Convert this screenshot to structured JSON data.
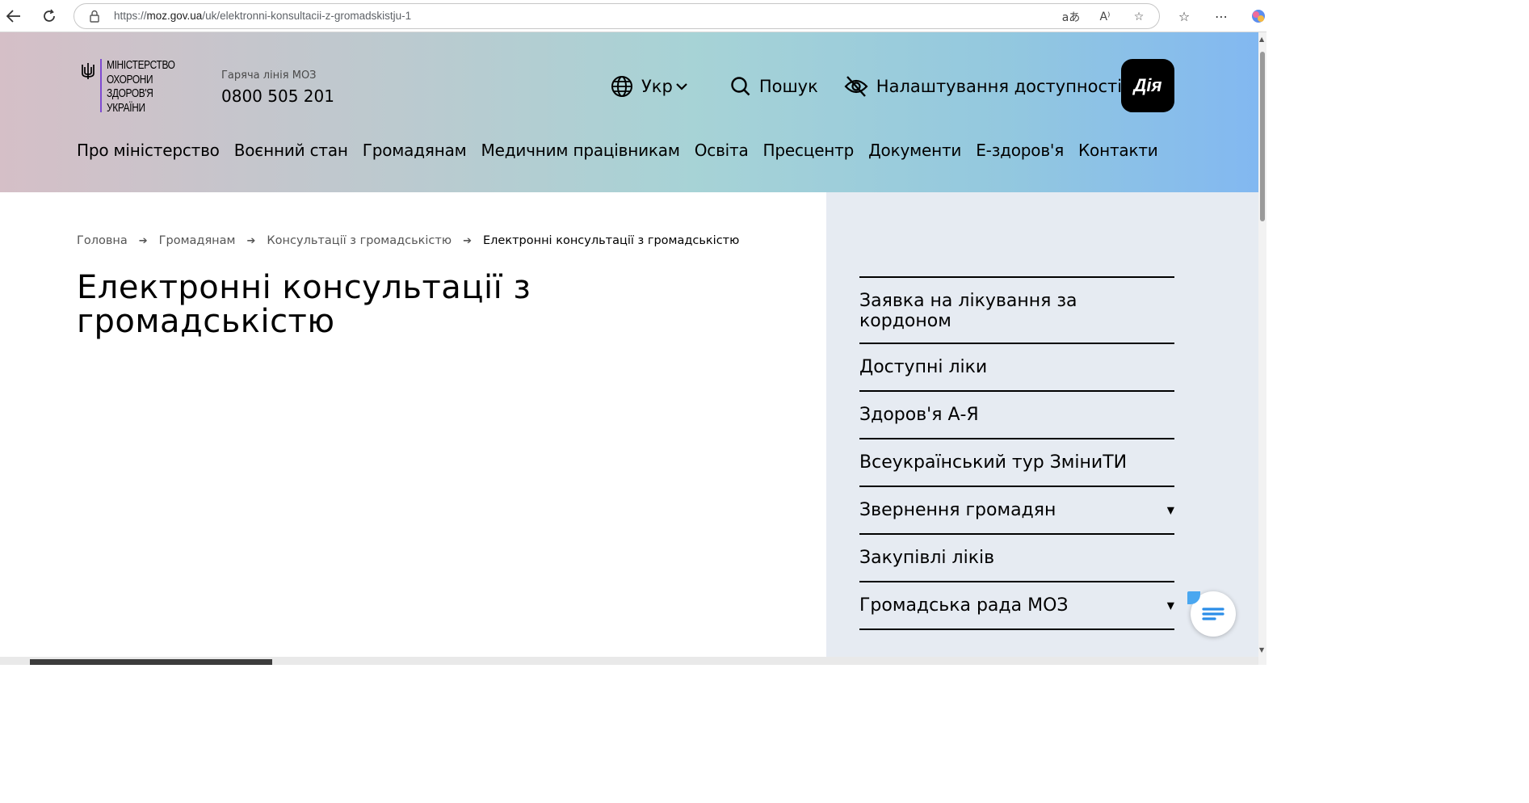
{
  "browser": {
    "url_prefix": "https://",
    "url_host": "moz.gov.ua",
    "url_path": "/uk/elektronni-konsultacii-z-gromadskistju-1"
  },
  "header": {
    "logo_lines": [
      "МІНІСТЕРСТВО",
      "ОХОРОНИ",
      "ЗДОРОВ'Я",
      "УКРАЇНИ"
    ],
    "hotline_label": "Гаряча лінія МОЗ",
    "hotline_phone": "0800 505 201",
    "language": "Укр",
    "search": "Пошук",
    "accessibility": "Налаштування доступності",
    "diia": "Дія"
  },
  "nav": [
    "Про міністерство",
    "Воєнний стан",
    "Громадянам",
    "Медичним працівникам",
    "Освіта",
    "Пресцентр",
    "Документи",
    "Е-здоров'я",
    "Контакти"
  ],
  "breadcrumb": {
    "items": [
      "Головна",
      "Громадянам",
      "Консультації з громадськістю"
    ],
    "current": "Електронні консультації з громадськістю"
  },
  "page": {
    "title": "Електронні консультації з громадськістю"
  },
  "sidebar": {
    "items": [
      {
        "label": "Заявка на лікування за кордоном",
        "has_children": false
      },
      {
        "label": "Доступні ліки",
        "has_children": false
      },
      {
        "label": "Здоров'я А-Я",
        "has_children": false
      },
      {
        "label": "Всеукраїнський тур ЗміниТИ",
        "has_children": false
      },
      {
        "label": "Звернення громадян",
        "has_children": true
      },
      {
        "label": "Закупівлі ліків",
        "has_children": false
      },
      {
        "label": "Громадська рада МОЗ",
        "has_children": true
      }
    ]
  },
  "colors": {
    "accent_purple": "#7f4bd1",
    "sidebar_bg": "#e6ebf2",
    "chat_accent": "#4aa7f0"
  }
}
